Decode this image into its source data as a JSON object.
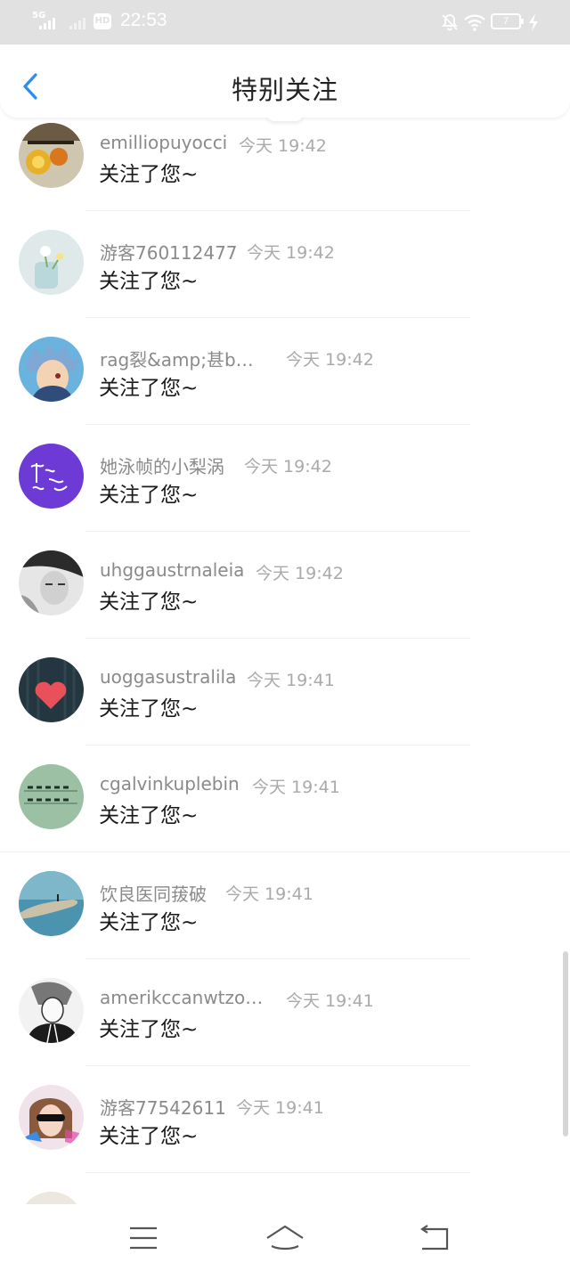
{
  "status_bar": {
    "network": "5G",
    "hd_badge": "HD",
    "time": "22:53",
    "battery_level": "7"
  },
  "header": {
    "title": "特别关注"
  },
  "notifications": [
    {
      "name": "emilliopuyocci",
      "time": "今天 19:42",
      "message": "关注了您~"
    },
    {
      "name": "游客760112477",
      "time": "今天 19:42",
      "message": "关注了您~"
    },
    {
      "name": "rag裂&amp;甚b…",
      "time": "今天 19:42",
      "message": "关注了您~"
    },
    {
      "name": "她泳帧的小梨涡",
      "time": "今天 19:42",
      "message": "关注了您~"
    },
    {
      "name": "uhggaustrnaleia",
      "time": "今天 19:42",
      "message": "关注了您~"
    },
    {
      "name": "uoggasustralila",
      "time": "今天 19:41",
      "message": "关注了您~"
    },
    {
      "name": "cgalvinkuplebin",
      "time": "今天 19:41",
      "message": "关注了您~"
    },
    {
      "name": "饮良医同菝破",
      "time": "今天 19:41",
      "message": "关注了您~"
    },
    {
      "name": "amerikccanwtzo…",
      "time": "今天 19:41",
      "message": "关注了您~"
    },
    {
      "name": "游客77542611",
      "time": "今天 19:41",
      "message": "关注了您~"
    },
    {
      "name": "",
      "time": "",
      "message": ""
    }
  ],
  "icons": {
    "back": "chevron-left-icon",
    "menu": "menu-icon",
    "home": "home-icon",
    "return": "return-icon"
  },
  "colors": {
    "accent": "#2b8df0",
    "status_bar_bg": "#e1e1e1",
    "name_text": "#8a8a8a",
    "time_text": "#aaaaaa",
    "message_text": "#1a1a1a"
  }
}
